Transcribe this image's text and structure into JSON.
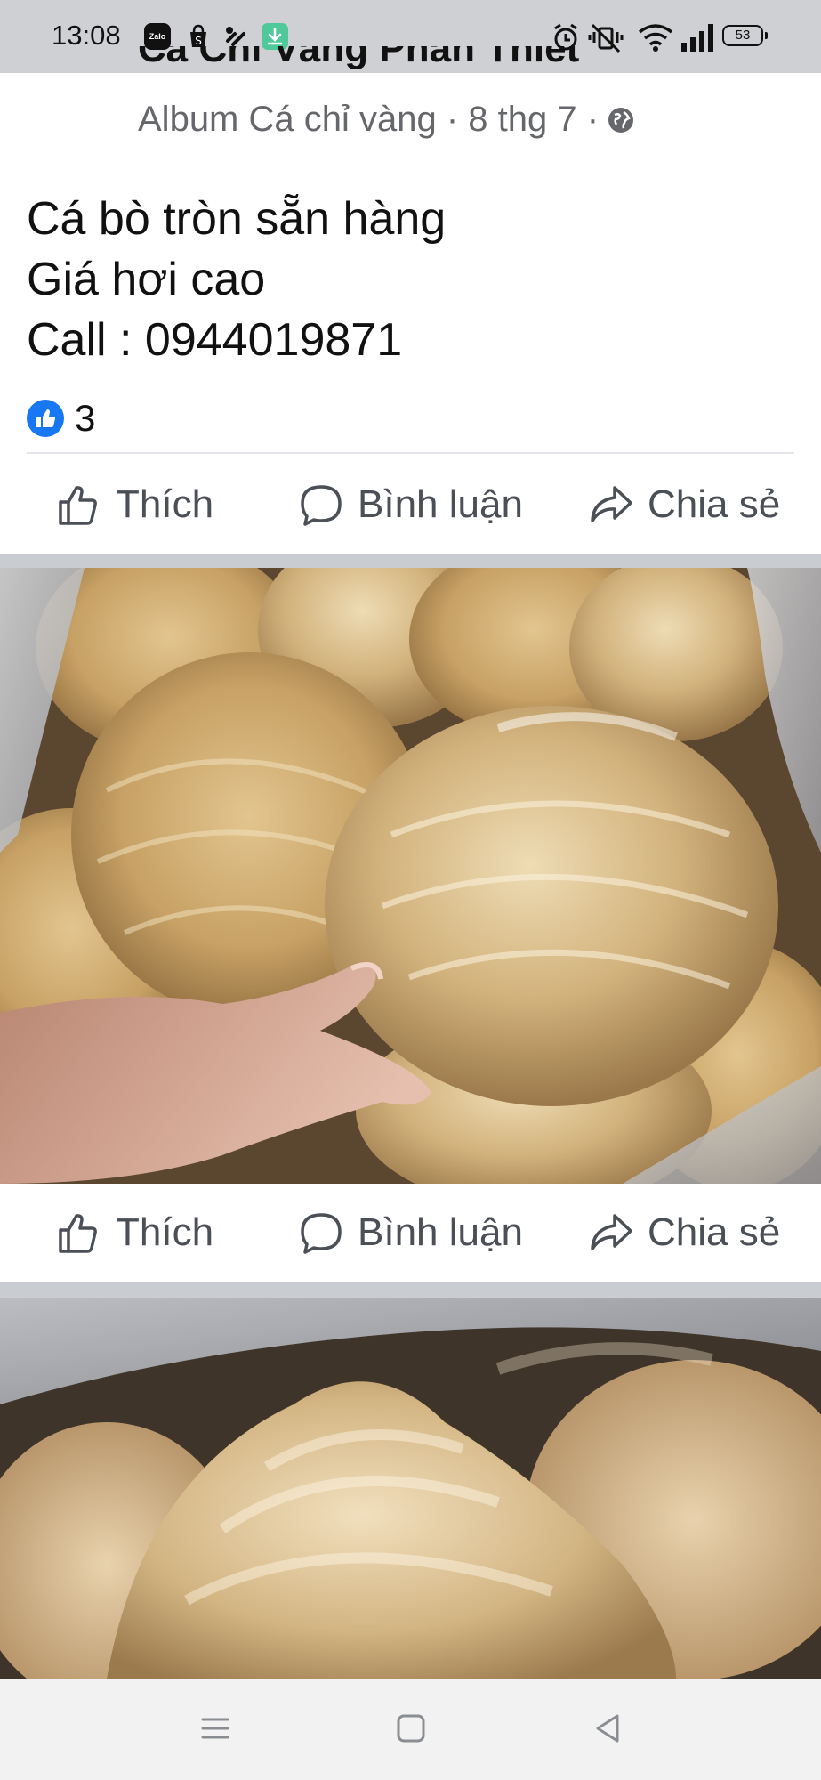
{
  "status_bar": {
    "time": "13:08",
    "apps": [
      "zalo-icon",
      "shopee-icon",
      "link-icon",
      "download-icon"
    ],
    "zalo_label": "Zalo",
    "battery": "53"
  },
  "post": {
    "page_name": "Cá Chỉ Vàng Phan Thiết Lon",
    "meta": "Album Cá chỉ vàng · 8 thg 7 ·",
    "lines": [
      "Cá bò tròn sẵn hàng",
      "Giá hơi cao",
      "Call : 0944019871"
    ],
    "reaction_count": "3"
  },
  "actions": {
    "like": "Thích",
    "comment": "Bình luận",
    "share": "Chia sẻ"
  },
  "colors": {
    "facebook_blue": "#1877f2",
    "status_bar": "#ced0d4",
    "separator": "#c9ccd1"
  }
}
